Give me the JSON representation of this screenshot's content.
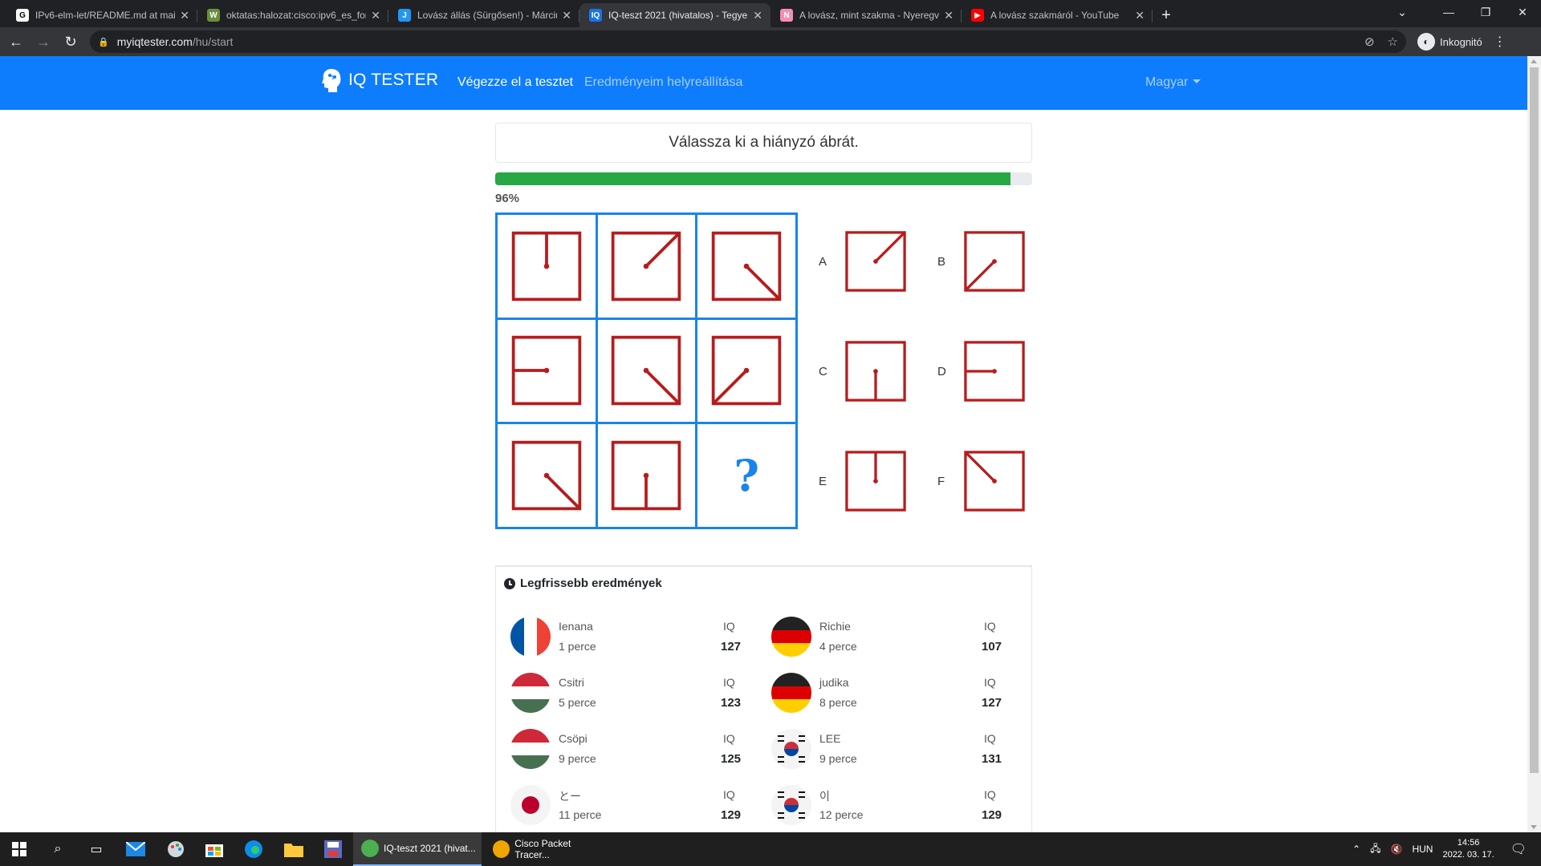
{
  "browser": {
    "tabs": [
      {
        "title": "IPv6-elm-let/README.md at mai",
        "fav_color": "#ffffff",
        "fav_text": "G"
      },
      {
        "title": "oktatas:halozat:cisco:ipv6_es_forg",
        "fav_color": "#6a8f3c",
        "fav_text": "W"
      },
      {
        "title": "Lovász állás (Sürgősen!) - Márciu",
        "fav_color": "#2196f3",
        "fav_text": "J"
      },
      {
        "title": "IQ-teszt 2021 (hivatalos) - Tegye",
        "fav_color": "#1a73e8",
        "fav_text": "IQ",
        "active": true
      },
      {
        "title": "A lovász, mint szakma - Nyeregv",
        "fav_color": "#f48fb1",
        "fav_text": "N"
      },
      {
        "title": "A lovász szakmáról - YouTube",
        "fav_color": "#ff0000",
        "fav_text": "▶"
      }
    ],
    "url_host": "myiqtester.com",
    "url_path": "/hu/start",
    "incognito_label": "Inkognitó"
  },
  "header": {
    "brand": "IQ TESTER",
    "nav_take": "Végezze el a tesztet",
    "nav_restore": "Eredményeim helyreállítása",
    "language": "Magyar"
  },
  "question": {
    "text": "Válassza ki a hiányzó ábrát.",
    "progress_percent": 96,
    "progress_label": "96%",
    "missing_mark": "?"
  },
  "matrix": [
    [
      "up",
      "up-right",
      "down-right"
    ],
    [
      "left",
      "down-right",
      "down-left"
    ],
    [
      "down-right",
      "down",
      "missing"
    ]
  ],
  "options": [
    {
      "label": "A",
      "direction": "up-right"
    },
    {
      "label": "B",
      "direction": "down-left"
    },
    {
      "label": "C",
      "direction": "down"
    },
    {
      "label": "D",
      "direction": "left"
    },
    {
      "label": "E",
      "direction": "up"
    },
    {
      "label": "F",
      "direction": "up-left"
    }
  ],
  "results": {
    "title": "Legfrissebb eredmények",
    "iq_label": "IQ",
    "entries": [
      {
        "name": "Ienana",
        "time": "1 perce",
        "iq": "127",
        "flag": "fr"
      },
      {
        "name": "Richie",
        "time": "4 perce",
        "iq": "107",
        "flag": "de"
      },
      {
        "name": "Csitri",
        "time": "5 perce",
        "iq": "123",
        "flag": "hu"
      },
      {
        "name": "judika",
        "time": "8 perce",
        "iq": "127",
        "flag": "de"
      },
      {
        "name": "Csöpi",
        "time": "9 perce",
        "iq": "125",
        "flag": "hu"
      },
      {
        "name": "LEE",
        "time": "9 perce",
        "iq": "131",
        "flag": "kr"
      },
      {
        "name": "とー",
        "time": "11 perce",
        "iq": "129",
        "flag": "jp"
      },
      {
        "name": "이",
        "time": "12 perce",
        "iq": "129",
        "flag": "kr"
      }
    ]
  },
  "taskbar": {
    "apps": [
      {
        "label": "IQ-teszt 2021 (hivat...",
        "active": true
      },
      {
        "label": "Cisco Packet Tracer...",
        "active": false
      }
    ],
    "lang": "HUN",
    "time": "14:56",
    "date": "2022. 03. 17."
  },
  "colors": {
    "brand_blue": "#0d7dfd",
    "matrix_blue": "#1a84ea",
    "figure_red": "#b71c1c",
    "progress_green": "#28a745"
  }
}
